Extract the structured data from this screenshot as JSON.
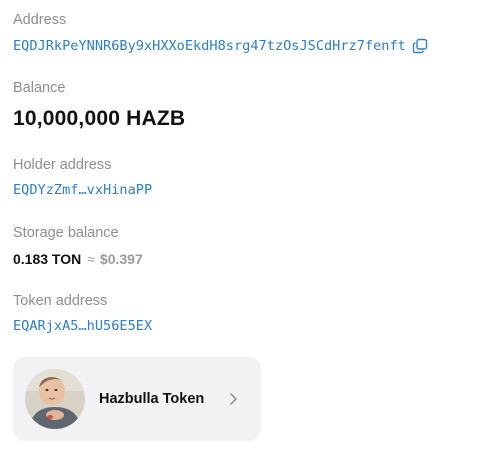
{
  "address": {
    "label": "Address",
    "value": "EQDJRkPeYNNR6By9xHXXoEkdH8srg47tzOsJSCdHrz7fenft",
    "copy_icon": "copy-icon"
  },
  "balance": {
    "label": "Balance",
    "value": "10,000,000 HAZB"
  },
  "holder": {
    "label": "Holder address",
    "value": "EQDYzZmf…vxHinaPP"
  },
  "storage": {
    "label": "Storage balance",
    "ton": "0.183 TON",
    "approx": "≈",
    "usd": "$0.397"
  },
  "token_address": {
    "label": "Token address",
    "value": "EQARjxA5…hU56E5EX"
  },
  "token_card": {
    "name": "Hazbulla Token",
    "avatar_icon": "token-avatar",
    "chevron_icon": "chevron-right-icon"
  },
  "colors": {
    "link": "#2f7ec8",
    "label": "#8e8e93",
    "card_bg": "#f2f2f4"
  }
}
